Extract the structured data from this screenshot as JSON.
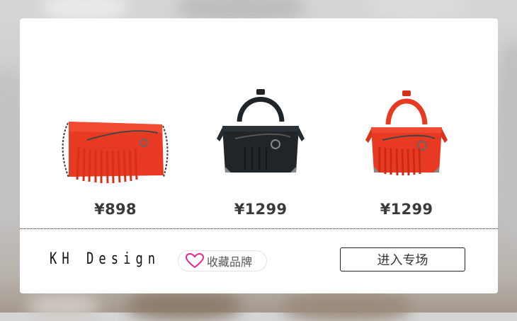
{
  "brand": {
    "name": "KH Design",
    "favorite_label": "收藏品牌",
    "enter_label": "进入专场"
  },
  "products": [
    {
      "price": "¥898",
      "image": "red-fringe-crossbody-bag",
      "color": "#e83a22"
    },
    {
      "price": "¥1299",
      "image": "black-mini-tote-bag",
      "color": "#1f2529"
    },
    {
      "price": "¥1299",
      "image": "red-fringe-mini-tote-bag",
      "color": "#e83a22"
    }
  ],
  "icons": {
    "favorite": "heart-icon"
  },
  "colors": {
    "accent": "#e8248c",
    "text": "#3a3a3a"
  }
}
